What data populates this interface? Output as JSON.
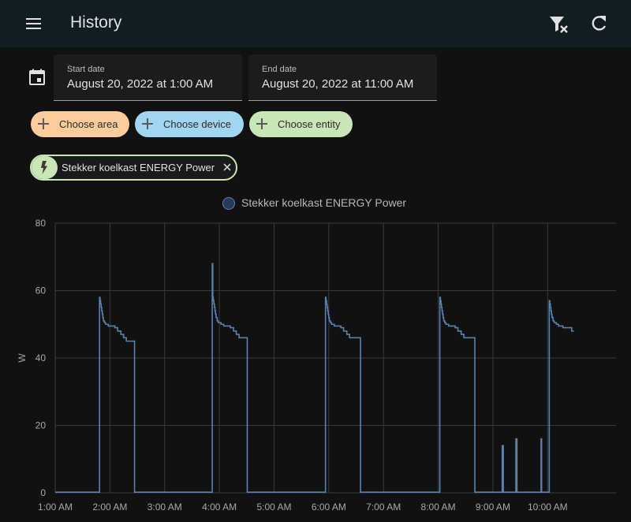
{
  "header": {
    "title": "History",
    "menu_icon": "menu-icon",
    "filter_remove_icon": "filter-remove-icon",
    "refresh_icon": "refresh-icon"
  },
  "date_picker": {
    "icon": "calendar-icon",
    "start": {
      "label": "Start date",
      "value": "August 20, 2022 at 1:00 AM"
    },
    "end": {
      "label": "End date",
      "value": "August 20, 2022 at 11:00 AM"
    }
  },
  "target_chips": {
    "area": "Choose area",
    "device": "Choose device",
    "entity": "Choose entity"
  },
  "selected_entity": {
    "label": "Stekker koelkast ENERGY Power",
    "icon": "flash-icon",
    "remove_icon": "close-icon"
  },
  "colors": {
    "series": "#5b82ad",
    "chip_area": "#fdcb9c",
    "chip_device": "#a1d5f2",
    "chip_entity": "#c8e6b6",
    "header_bg": "#101e24"
  },
  "chart_data": {
    "type": "line",
    "step": true,
    "legend_position": "top-center",
    "grid": true,
    "ylabel": "W",
    "ylim": [
      0,
      80
    ],
    "yticks": [
      0,
      20,
      40,
      60,
      80
    ],
    "xlim": [
      1.0,
      11.25
    ],
    "xticks": [
      "1:00 AM",
      "2:00 AM",
      "3:00 AM",
      "4:00 AM",
      "5:00 AM",
      "6:00 AM",
      "7:00 AM",
      "8:00 AM",
      "9:00 AM",
      "10:00 AM"
    ],
    "series": [
      {
        "name": "Stekker koelkast ENERGY Power",
        "x": [
          1.0,
          1.81,
          1.81,
          1.82,
          1.83,
          1.84,
          1.85,
          1.86,
          1.87,
          1.88,
          1.9,
          1.92,
          1.97,
          2.02,
          2.09,
          2.14,
          2.2,
          2.25,
          2.3,
          2.45,
          2.45,
          2.46,
          3.87,
          3.87,
          3.88,
          3.89,
          3.9,
          3.91,
          3.92,
          3.93,
          3.94,
          3.96,
          3.98,
          4.03,
          4.08,
          4.15,
          4.2,
          4.26,
          4.31,
          4.36,
          4.51,
          4.51,
          4.52,
          5.94,
          5.94,
          5.95,
          5.96,
          5.97,
          5.98,
          5.99,
          6.0,
          6.01,
          6.03,
          6.05,
          6.1,
          6.15,
          6.22,
          6.27,
          6.33,
          6.38,
          6.43,
          6.58,
          6.58,
          8.03,
          8.03,
          8.04,
          8.05,
          8.06,
          8.07,
          8.08,
          8.09,
          8.1,
          8.12,
          8.14,
          8.19,
          8.24,
          8.31,
          8.36,
          8.42,
          8.47,
          8.52,
          8.67,
          8.67,
          9.17,
          9.17,
          9.19,
          9.19,
          9.42,
          9.42,
          9.44,
          9.44,
          9.88,
          9.88,
          9.89,
          9.89,
          10.03,
          10.03,
          10.04,
          10.05,
          10.06,
          10.07,
          10.08,
          10.1,
          10.12,
          10.16,
          10.2,
          10.28,
          10.36,
          10.44,
          10.48
        ],
        "y": [
          0.2,
          0.2,
          58,
          57,
          56,
          55,
          54,
          53,
          52,
          51,
          50.5,
          50,
          49.5,
          49.5,
          49,
          48,
          47,
          46,
          45,
          45,
          0.2,
          0.2,
          0.2,
          68,
          58,
          57,
          56,
          55,
          54,
          53,
          52,
          51,
          50.5,
          50,
          49.5,
          49.5,
          49,
          48,
          47,
          46,
          46,
          0.2,
          0.2,
          0.2,
          58,
          57,
          56,
          55,
          54,
          53,
          52,
          51,
          50.5,
          50,
          49.5,
          49.5,
          49,
          48,
          47,
          46,
          46,
          0.2,
          0.2,
          0.2,
          58,
          57,
          56,
          55,
          54,
          53,
          52,
          51,
          50.5,
          50,
          49.5,
          49.5,
          49,
          48,
          47,
          46,
          46,
          0.2,
          0.2,
          0.2,
          14,
          0.2,
          0.2,
          0.2,
          16,
          0.2,
          0.2,
          0.2,
          16,
          0.2,
          0.2,
          0.2,
          57,
          56,
          55,
          54,
          53,
          52,
          51,
          50.5,
          50,
          49.5,
          49,
          49,
          48,
          48
        ]
      }
    ]
  }
}
